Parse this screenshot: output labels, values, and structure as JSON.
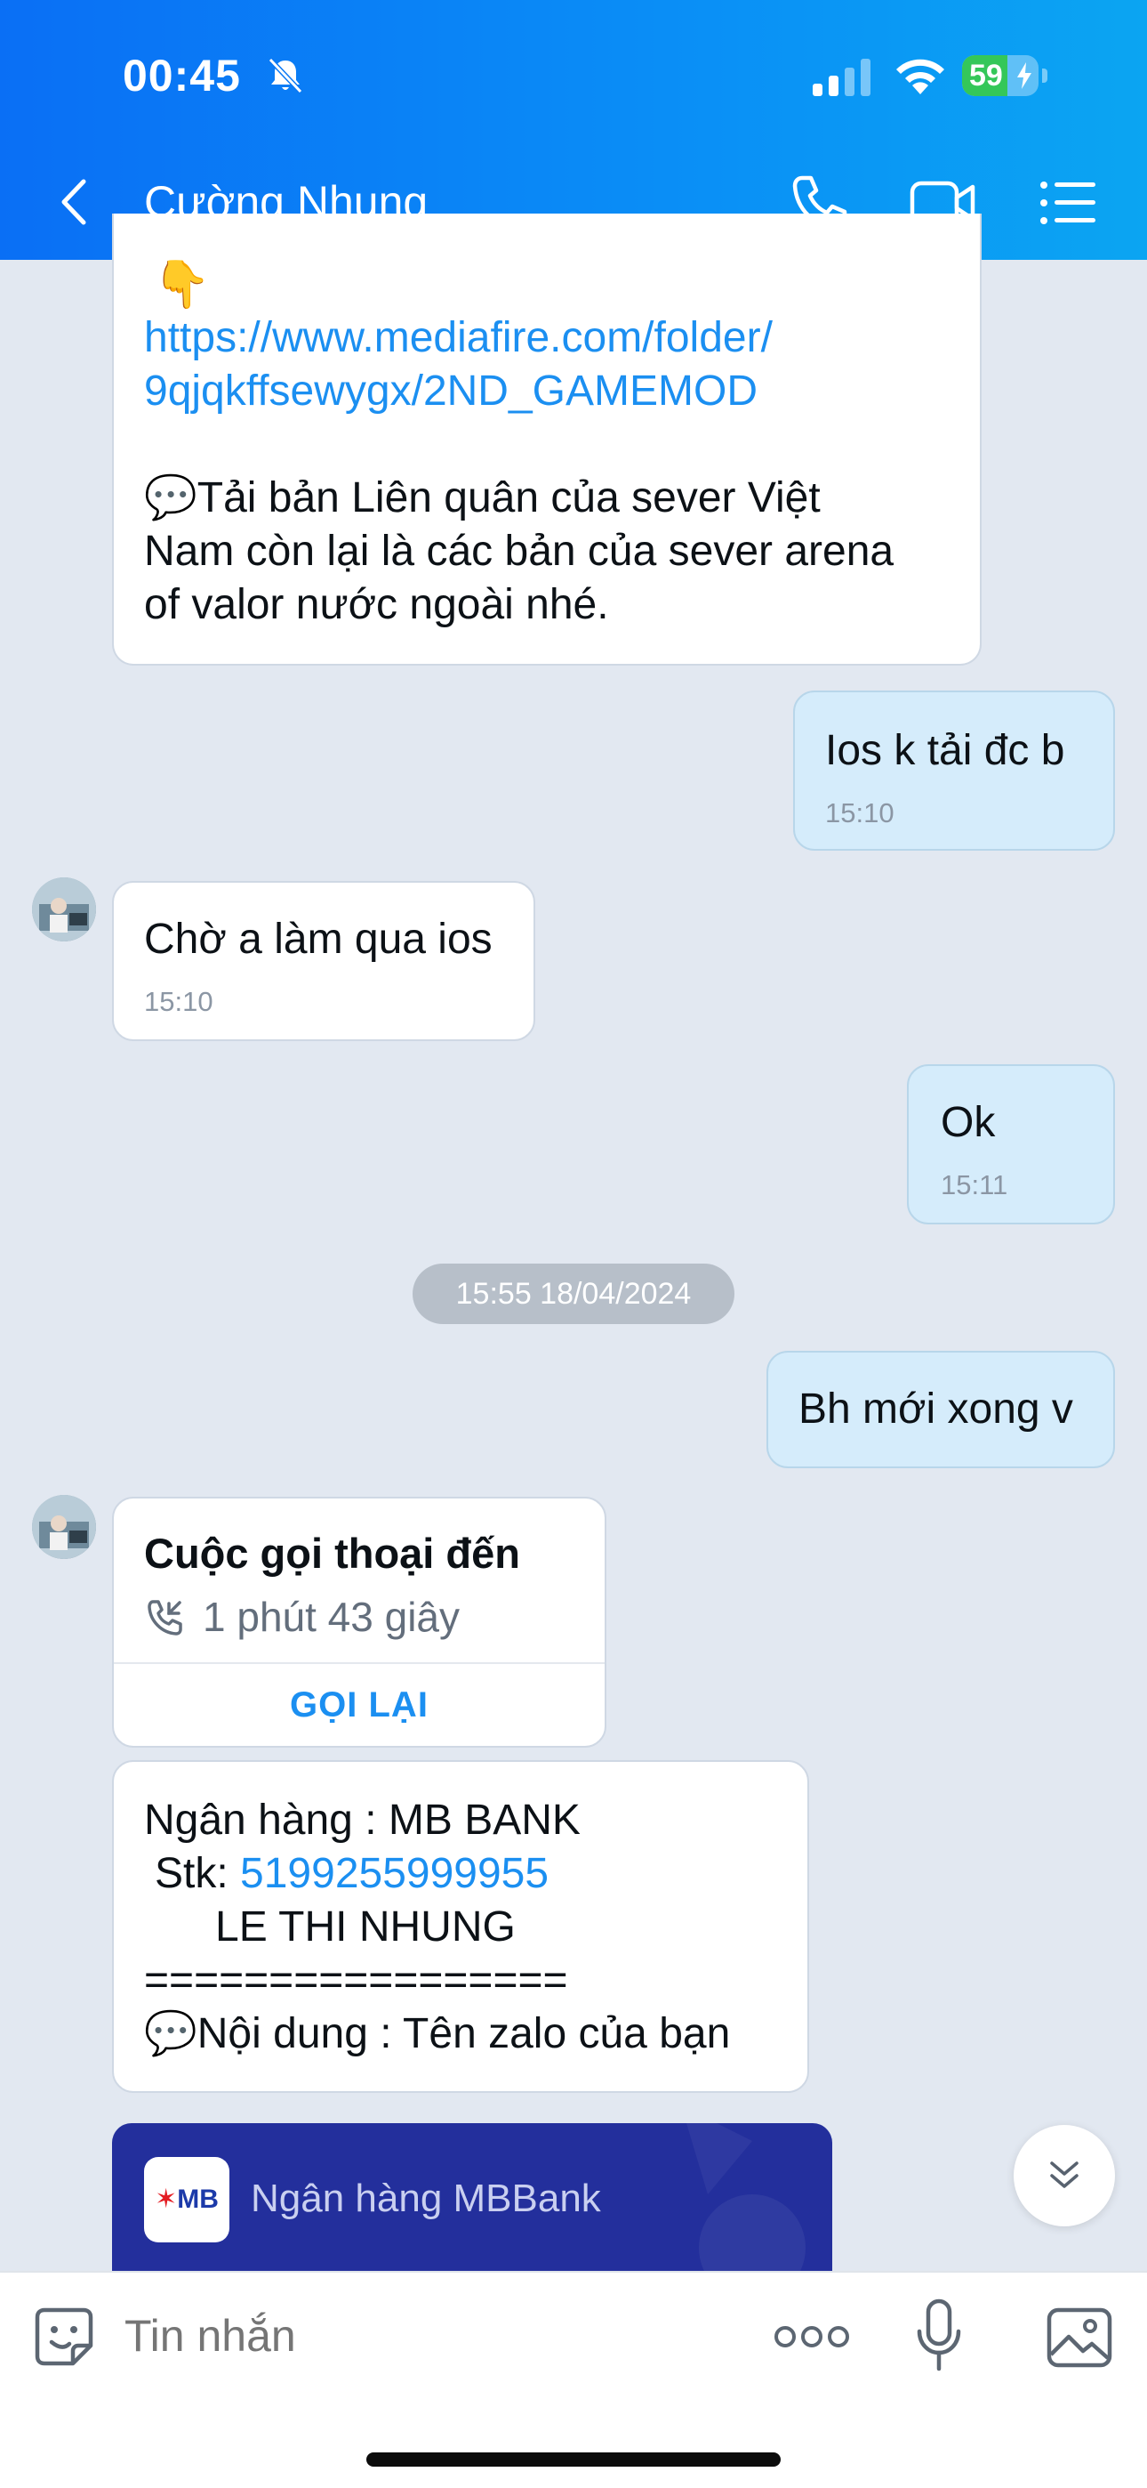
{
  "status_bar": {
    "time": "00:45",
    "battery": "59",
    "icons": [
      "bell-slash-icon",
      "signal-icon",
      "wifi-icon",
      "battery-charging-icon"
    ]
  },
  "header": {
    "contact_name": "Cường Nhung",
    "icons": [
      "back-chevron-icon",
      "phone-icon",
      "video-camera-icon",
      "menu-list-icon"
    ],
    "colors": {
      "gradient_start": "#0a6ff5",
      "gradient_end": "#0ba5f2"
    }
  },
  "messages": {
    "m1": {
      "emoji": "👇",
      "link_line1": "https://www.mediafire.com/folder/",
      "link_line2": "9qjqkffsewygx/2ND_GAMEMOD",
      "emoji2": "💬",
      "text_line1": "Tải bản Liên quân của sever Việt",
      "text_line2": "Nam còn lại là các bản của sever arena",
      "text_line3": "of valor nước ngoài nhé."
    },
    "m2": {
      "text": "Ios k tải đc b",
      "time": "15:10"
    },
    "m3": {
      "text": "Chờ a làm qua ios",
      "time": "15:10"
    },
    "m4": {
      "text": "Ok",
      "time": "15:11"
    },
    "date_separator": "15:55 18/04/2024",
    "m5": {
      "text": "Bh mới xong v"
    },
    "call": {
      "title": "Cuộc gọi thoại đến",
      "duration": "1 phút 43 giây",
      "action": "GỌI LẠI"
    },
    "bank_msg": {
      "line1": "Ngân hàng : MB BANK",
      "stk_label": "Stk: ",
      "stk_number": "5199255999955",
      "name": "LE THI NHUNG",
      "separator": "=================",
      "emoji": "💬",
      "content": "Nội dung : Tên zalo của bạn"
    },
    "bank_card": {
      "logo_text": "MB",
      "name": "Ngân hàng MBBank",
      "color": "#232f9c"
    }
  },
  "input_bar": {
    "placeholder": "Tin nhắn",
    "icons": [
      "sticker-face-icon",
      "more-dots-icon",
      "microphone-icon",
      "image-gallery-icon"
    ]
  }
}
